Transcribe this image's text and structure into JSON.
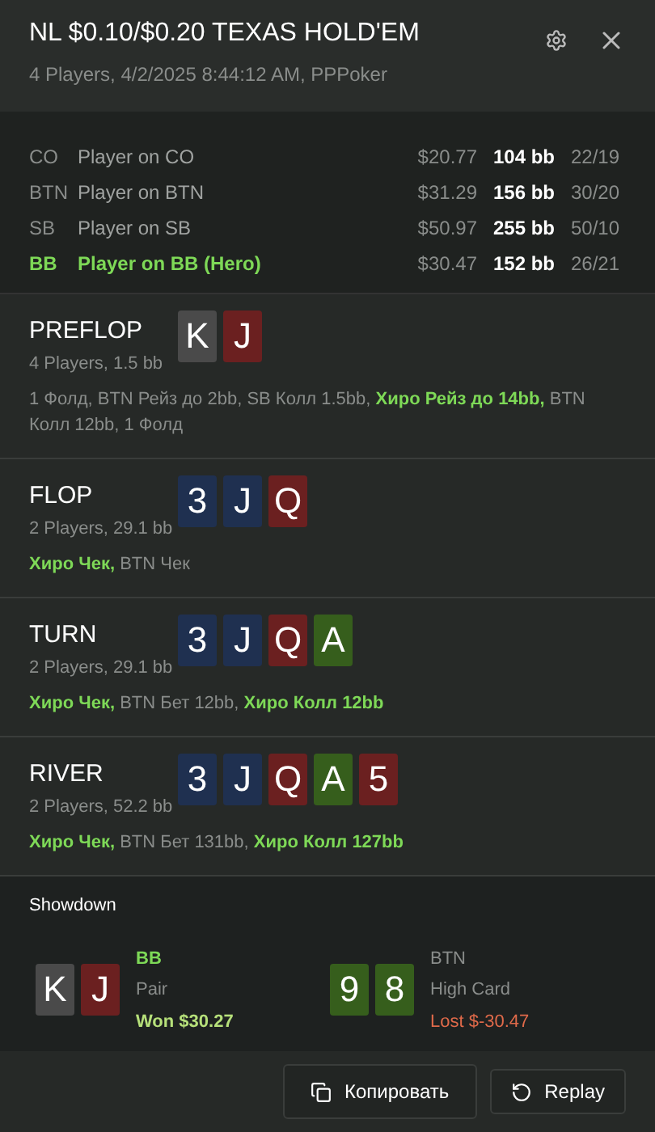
{
  "header": {
    "title": "NL $0.10/$0.20 TEXAS HOLD'EM",
    "subtitle": "4 Players, 4/2/2025 8:44:12 AM, PPPoker"
  },
  "players": [
    {
      "position": "CO",
      "name": "Player on CO",
      "stack": "$20.77",
      "bb": "104 bb",
      "stats": "22/19",
      "hero": false
    },
    {
      "position": "BTN",
      "name": "Player on BTN",
      "stack": "$31.29",
      "bb": "156 bb",
      "stats": "30/20",
      "hero": false
    },
    {
      "position": "SB",
      "name": "Player on SB",
      "stack": "$50.97",
      "bb": "255 bb",
      "stats": "50/10",
      "hero": false
    },
    {
      "position": "BB",
      "name": "Player on BB (Hero)",
      "stack": "$30.47",
      "bb": "152 bb",
      "stats": "26/21",
      "hero": true
    }
  ],
  "streets": [
    {
      "name": "PREFLOP",
      "info": "4 Players, 1.5 bb",
      "cards": [
        {
          "rank": "K",
          "color": "#4a4a4a"
        },
        {
          "rank": "J",
          "color": "#6b2020"
        }
      ],
      "actions": "1 Фолд, BTN Рейз до 2bb, SB Колл 1.5bb, **Хиро Рейз до 14bb,** BTN Колл 12bb, 1 Фолд"
    },
    {
      "name": "FLOP",
      "info": "2 Players, 29.1 bb",
      "cards": [
        {
          "rank": "3",
          "color": "#1f3050"
        },
        {
          "rank": "J",
          "color": "#1f3050"
        },
        {
          "rank": "Q",
          "color": "#6b2020"
        }
      ],
      "actions": "**Хиро Чек,** BTN Чек"
    },
    {
      "name": "TURN",
      "info": "2 Players, 29.1 bb",
      "cards": [
        {
          "rank": "3",
          "color": "#1f3050"
        },
        {
          "rank": "J",
          "color": "#1f3050"
        },
        {
          "rank": "Q",
          "color": "#6b2020"
        },
        {
          "rank": "A",
          "color": "#365e1c"
        }
      ],
      "actions": "**Хиро Чек,** BTN Бет 12bb, **Хиро Колл 12bb**"
    },
    {
      "name": "RIVER",
      "info": "2 Players, 52.2 bb",
      "cards": [
        {
          "rank": "3",
          "color": "#1f3050"
        },
        {
          "rank": "J",
          "color": "#1f3050"
        },
        {
          "rank": "Q",
          "color": "#6b2020"
        },
        {
          "rank": "A",
          "color": "#365e1c"
        },
        {
          "rank": "5",
          "color": "#6b2020"
        }
      ],
      "actions": "**Хиро Чек,** BTN Бет 131bb, **Хиро Колл 127bb**"
    }
  ],
  "showdown": {
    "title": "Showdown",
    "hands": [
      {
        "position": "BB",
        "hero": true,
        "cards": [
          {
            "rank": "K",
            "color": "#4a4a4a"
          },
          {
            "rank": "J",
            "color": "#6b2020"
          }
        ],
        "hand": "Pair",
        "result": "Won $30.27",
        "kind": "won"
      },
      {
        "position": "BTN",
        "hero": false,
        "cards": [
          {
            "rank": "9",
            "color": "#365e1c"
          },
          {
            "rank": "8",
            "color": "#365e1c"
          }
        ],
        "hand": "High Card",
        "result": "Lost $-30.47",
        "kind": "lost"
      }
    ]
  },
  "buttons": [
    {
      "label": "Копировать",
      "kind": "copy"
    },
    {
      "label": "Replay",
      "kind": "replay"
    }
  ]
}
